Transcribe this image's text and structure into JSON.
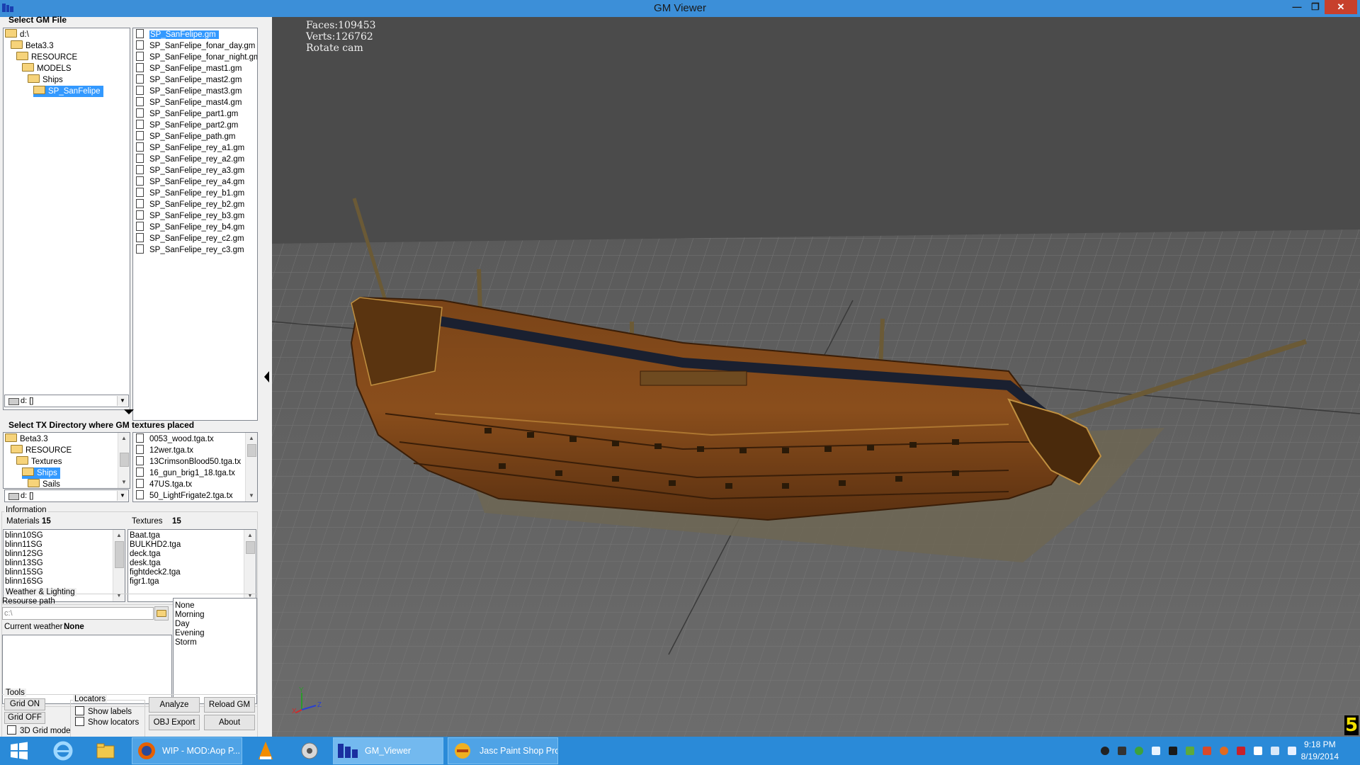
{
  "window": {
    "title": "GM Viewer"
  },
  "gm_panel": {
    "title": "Select GM File",
    "tree": [
      {
        "label": "d:\\",
        "indent": 0,
        "selected": false
      },
      {
        "label": "Beta3.3",
        "indent": 1,
        "selected": false
      },
      {
        "label": "RESOURCE",
        "indent": 2,
        "selected": false
      },
      {
        "label": "MODELS",
        "indent": 3,
        "selected": false
      },
      {
        "label": "Ships",
        "indent": 4,
        "selected": false
      },
      {
        "label": "SP_SanFelipe",
        "indent": 5,
        "selected": true
      }
    ],
    "files": [
      "SP_SanFelipe.gm",
      "SP_SanFelipe_fonar_day.gm",
      "SP_SanFelipe_fonar_night.gm",
      "SP_SanFelipe_mast1.gm",
      "SP_SanFelipe_mast2.gm",
      "SP_SanFelipe_mast3.gm",
      "SP_SanFelipe_mast4.gm",
      "SP_SanFelipe_part1.gm",
      "SP_SanFelipe_part2.gm",
      "SP_SanFelipe_path.gm",
      "SP_SanFelipe_rey_a1.gm",
      "SP_SanFelipe_rey_a2.gm",
      "SP_SanFelipe_rey_a3.gm",
      "SP_SanFelipe_rey_a4.gm",
      "SP_SanFelipe_rey_b1.gm",
      "SP_SanFelipe_rey_b2.gm",
      "SP_SanFelipe_rey_b3.gm",
      "SP_SanFelipe_rey_b4.gm",
      "SP_SanFelipe_rey_c2.gm",
      "SP_SanFelipe_rey_c3.gm"
    ],
    "selected_file_index": 0,
    "drive": "d: []"
  },
  "tx_panel": {
    "title": "Select TX Directory where GM textures placed",
    "tree": [
      {
        "label": "Beta3.3",
        "indent": 0,
        "selected": false
      },
      {
        "label": "RESOURCE",
        "indent": 1,
        "selected": false
      },
      {
        "label": "Textures",
        "indent": 2,
        "selected": false
      },
      {
        "label": "Ships",
        "indent": 3,
        "selected": true
      },
      {
        "label": "Sails",
        "indent": 4,
        "selected": false
      }
    ],
    "files": [
      "0053_wood.tga.tx",
      "12wer.tga.tx",
      "13CrimsonBlood50.tga.tx",
      "16_gun_brig1_18.tga.tx",
      "47US.tga.tx",
      "50_LightFrigate2.tga.tx"
    ],
    "drive": "d: []"
  },
  "info": {
    "legend": "Information",
    "materials_label": "Materials",
    "materials_count": "15",
    "textures_label": "Textures",
    "textures_count": "15",
    "materials": [
      "blinn10SG",
      "blinn11SG",
      "blinn12SG",
      "blinn13SG",
      "blinn15SG",
      "blinn16SG"
    ],
    "textures": [
      "Baat.tga",
      "BULKHD2.tga",
      "deck.tga",
      "desk.tga",
      "fightdeck2.tga",
      "figr1.tga"
    ]
  },
  "weather": {
    "legend": "Weather & Lighting",
    "resource_path_label": "Resourse path",
    "resource_path_value": "c:\\",
    "current_label": "Current weather :",
    "current_value": "None",
    "options": [
      "None",
      "Morning",
      "Day",
      "Evening",
      "Storm"
    ]
  },
  "tools": {
    "legend": "Tools",
    "grid_on": "Grid ON",
    "grid_off": "Grid OFF",
    "grid_3d": "3D Grid mode",
    "locators_legend": "Locators",
    "show_labels": "Show labels",
    "show_locators": "Show locators",
    "analyze": "Analyze",
    "reload_gm": "Reload GM",
    "obj_export": "OBJ Export",
    "about": "About"
  },
  "viewport": {
    "faces_label": "Faces:109453",
    "verts_label": "Verts:126762",
    "mode_label": "Rotate cam",
    "stat_number": "5",
    "axis_y": "Y",
    "axis_z": "Z",
    "axis_x": "X"
  },
  "taskbar": {
    "tasks": [
      {
        "label": "WIP - MOD:Aop P...",
        "active": false
      },
      {
        "label": "GM_Viewer",
        "active": true
      },
      {
        "label": "Jasc Paint Shop Pro",
        "active": false
      }
    ],
    "time": "9:18 PM",
    "date": "8/19/2014"
  }
}
